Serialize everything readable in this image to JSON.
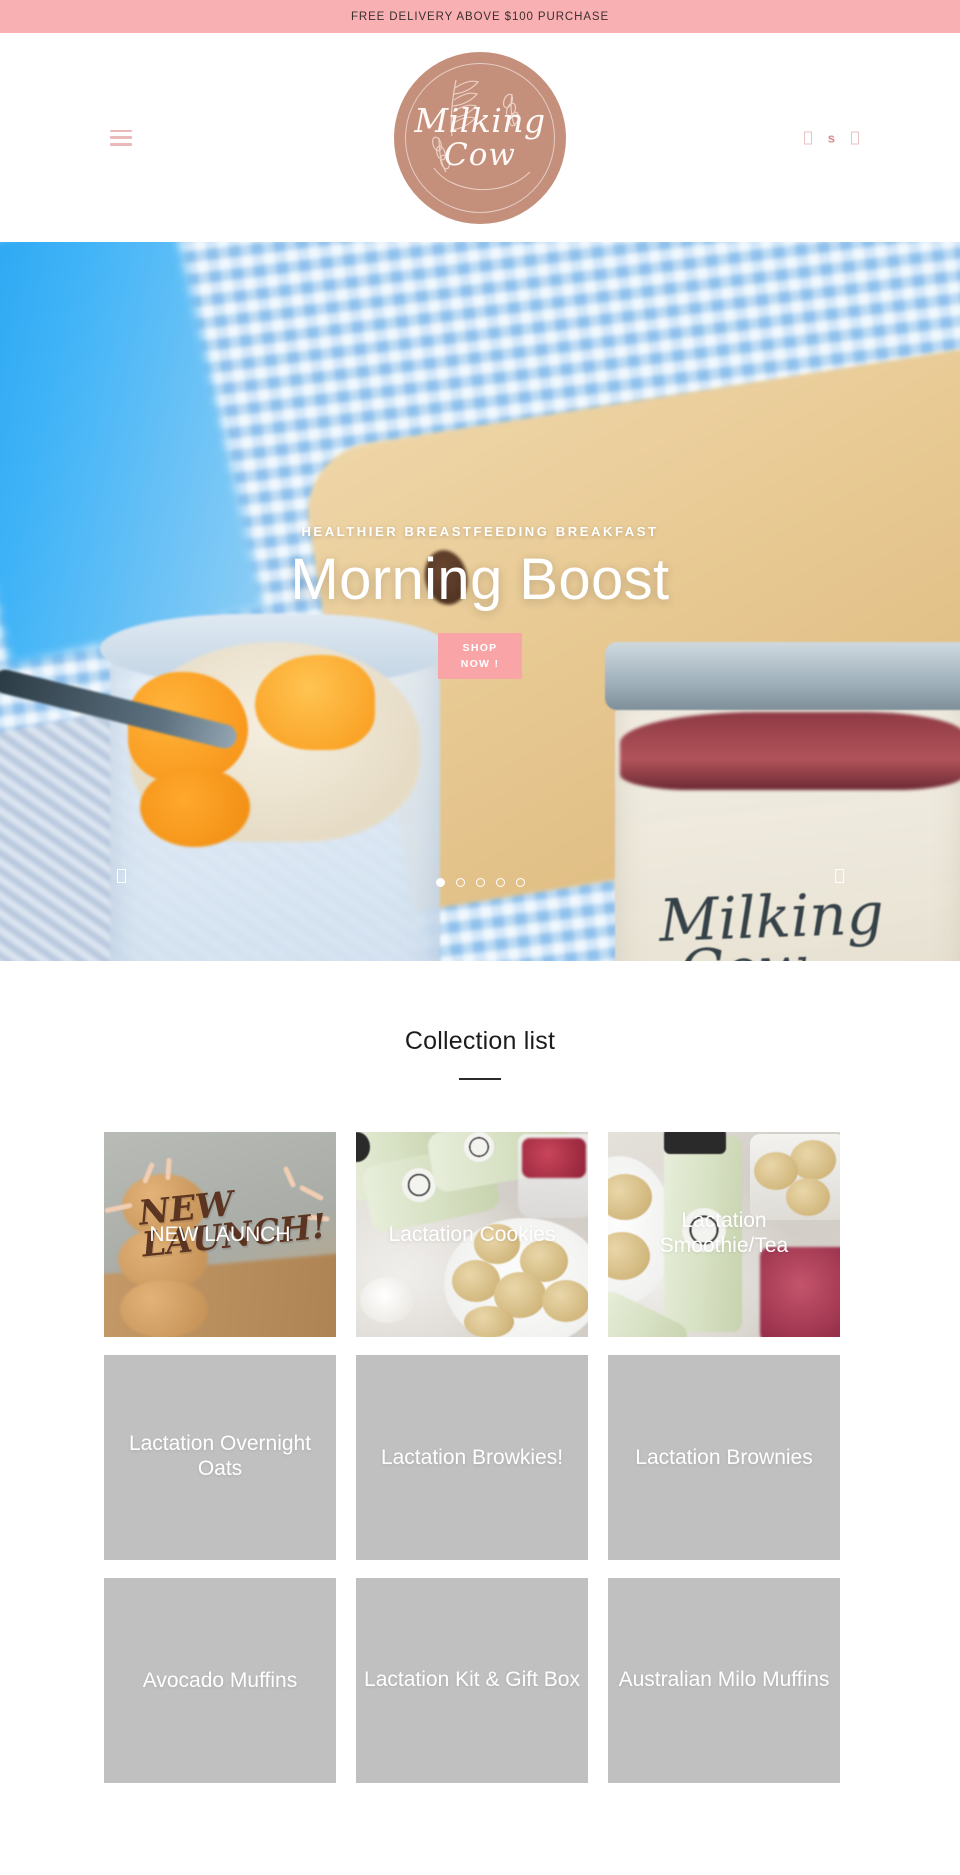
{
  "announcement": {
    "text": "FREE DELIVERY ABOVE $100 PURCHASE",
    "bg_color": "#f9b0b3"
  },
  "header": {
    "menu_icon": "hamburger-menu-icon",
    "logo": {
      "line1": "Milking",
      "line2": "Cow",
      "bg_color": "#c4907c"
    },
    "icons": [
      {
        "name": "search-icon",
        "glyph": "box"
      },
      {
        "name": "account-icon",
        "glyph": "s"
      },
      {
        "name": "cart-icon",
        "glyph": "box"
      }
    ]
  },
  "hero": {
    "subtitle": "HEALTHIER BREASTFEEDING BREAKFAST",
    "title": "Morning Boost",
    "cta_line1": "SHOP",
    "cta_line2": "NOW !",
    "cta_color": "#f9a5a7",
    "jar_brand_line1": "Milking",
    "jar_brand_line2": "Cow",
    "prev_arrow": "chevron-left-icon",
    "next_arrow": "chevron-right-icon",
    "slide_count": 5,
    "active_slide": 1
  },
  "collections": {
    "title": "Collection list",
    "items": [
      {
        "label": "NEW LAUNCH",
        "image": "new-launch-cookies",
        "overlay_script": "NEW LAUNCH!"
      },
      {
        "label": "Lactation Cookies",
        "image": "cookies-plate-bottles"
      },
      {
        "label": "Lactation Smoothie/Tea",
        "image": "smoothie-bottles-marble"
      },
      {
        "label": "Lactation Overnight Oats",
        "image": "placeholder"
      },
      {
        "label": "Lactation Browkies!",
        "image": "placeholder"
      },
      {
        "label": "Lactation Brownies",
        "image": "placeholder"
      },
      {
        "label": "Avocado Muffins",
        "image": "placeholder"
      },
      {
        "label": "Lactation Kit & Gift Box",
        "image": "placeholder"
      },
      {
        "label": "Australian Milo Muffins",
        "image": "placeholder"
      }
    ]
  }
}
